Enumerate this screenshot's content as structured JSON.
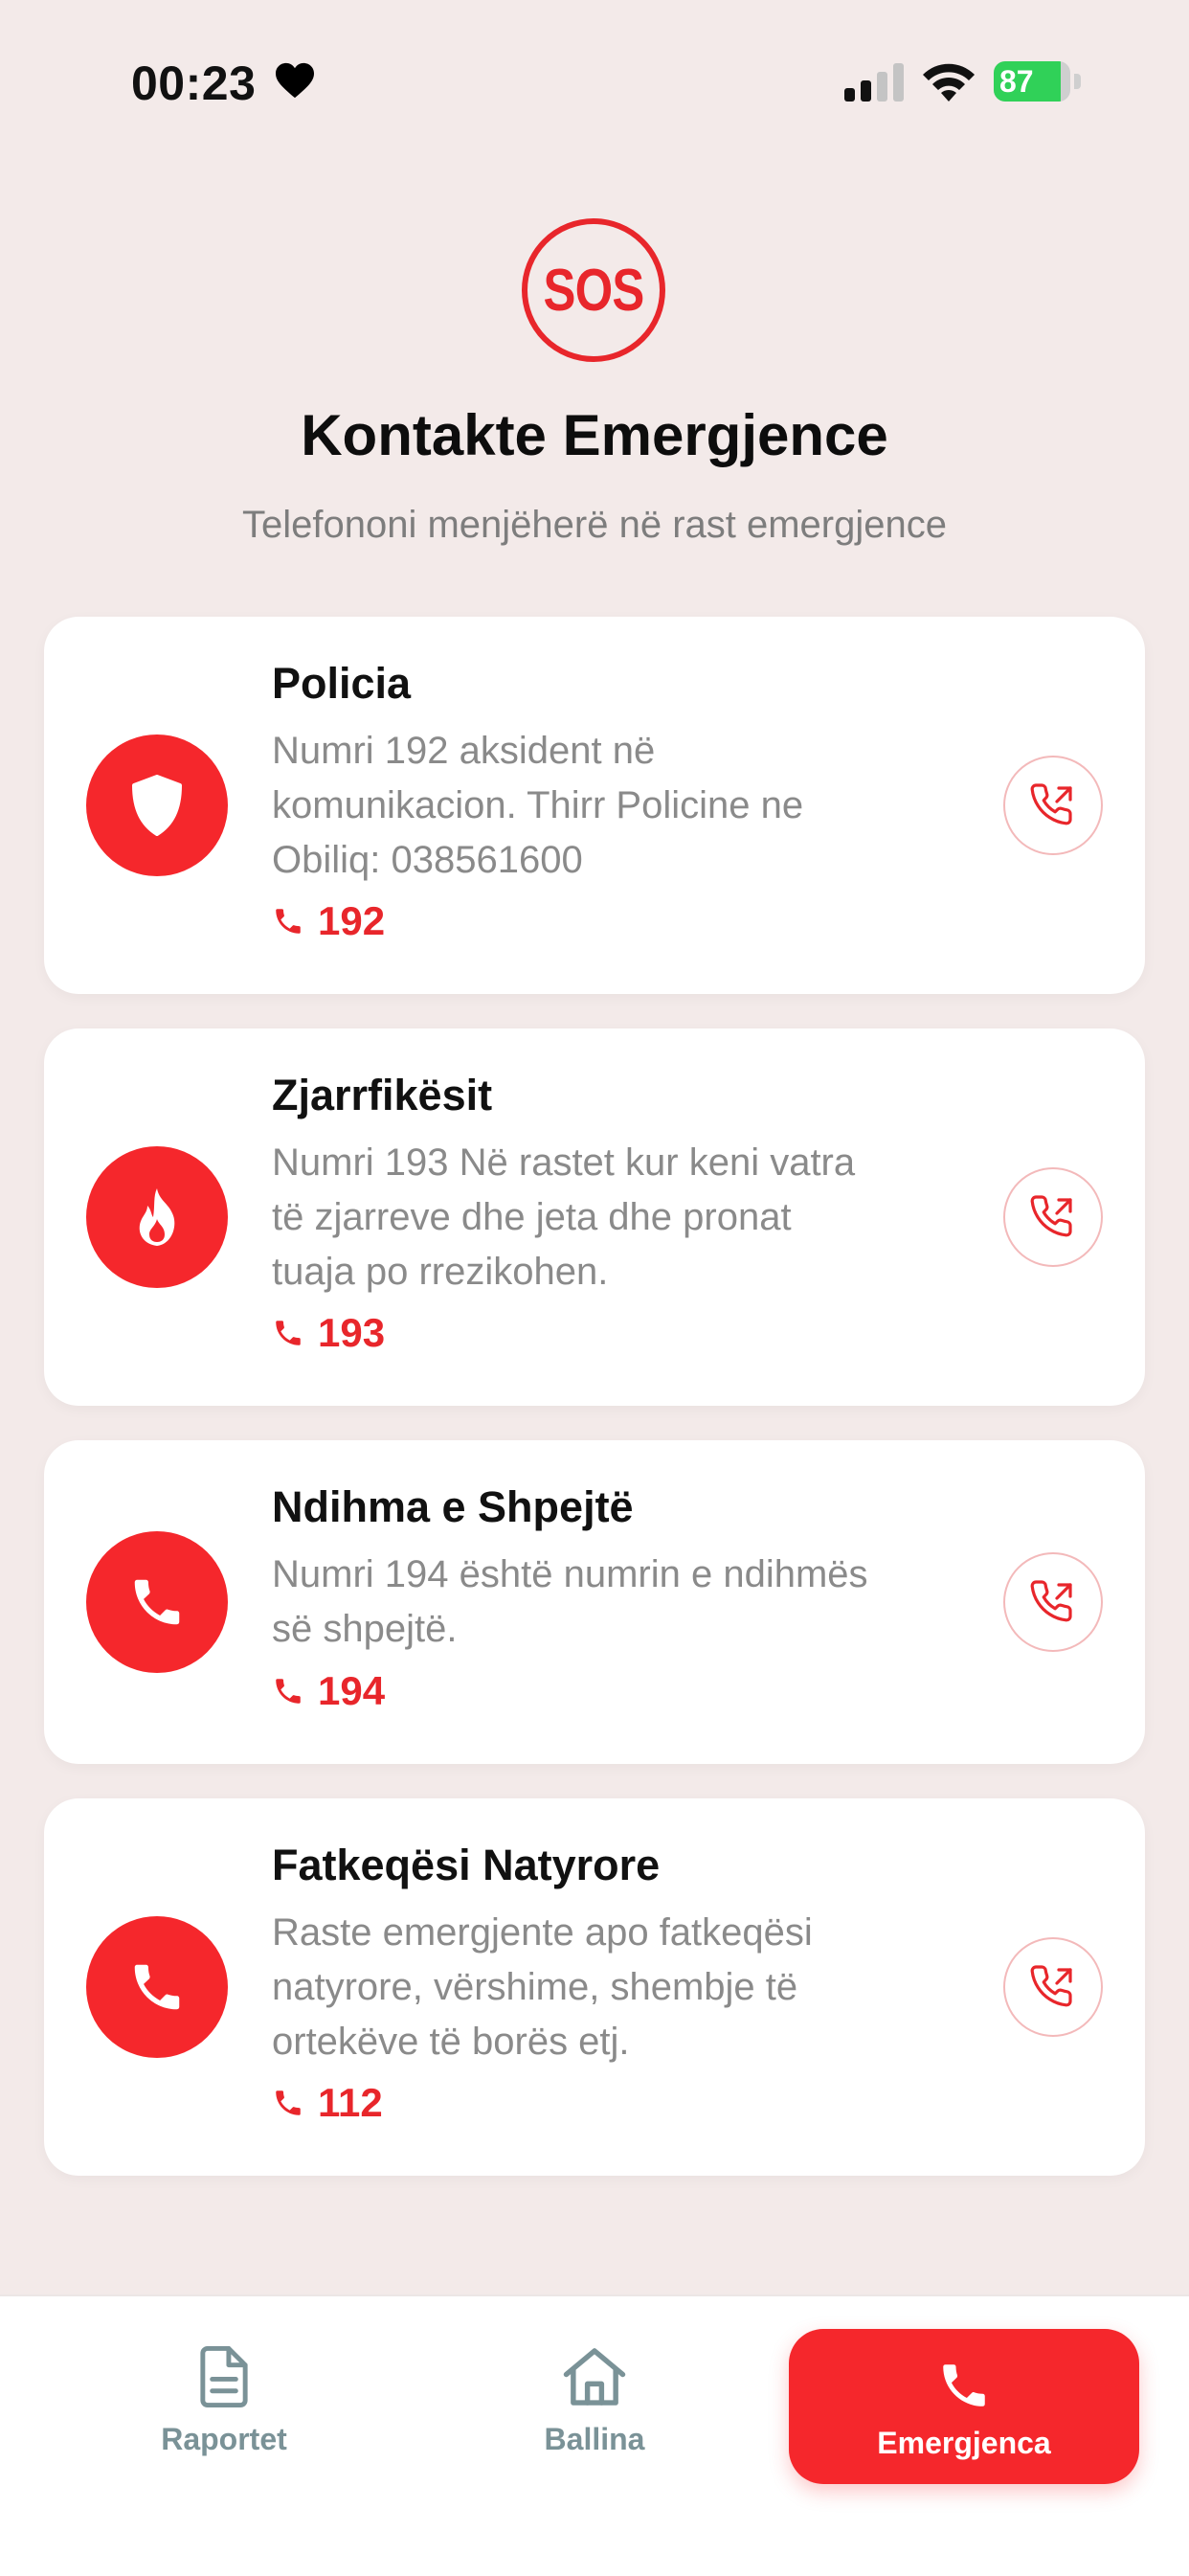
{
  "status_bar": {
    "time": "00:23",
    "battery_level": 87,
    "battery_text": "87",
    "icons": [
      "heart-icon",
      "cellular-signal-icon",
      "wifi-icon",
      "battery-icon"
    ]
  },
  "header": {
    "badge_text": "SOS",
    "title": "Kontakte Emergjence",
    "subtitle": "Telefononi menjëherë në rast emergjence"
  },
  "contacts": [
    {
      "title": "Policia",
      "description": "Numri 192 aksident në komunikacion. Thirr Policine ne Obiliq: 038561600",
      "number": "192",
      "icon": "shield-icon"
    },
    {
      "title": "Zjarrfikësit",
      "description": "Numri 193 Në rastet kur keni vatra të zjarreve dhe jeta dhe pronat tuaja po rrezikohen.",
      "number": "193",
      "icon": "flame-icon"
    },
    {
      "title": "Ndihma e Shpejtë",
      "description": "Numri 194 është numrin e ndihmës së shpejtë.",
      "number": "194",
      "icon": "phone-icon"
    },
    {
      "title": "Fatkeqësi Natyrore",
      "description": "Raste emergjente apo fatkeqësi natyrore, vërshime, shembje të ortekëve të borës etj.",
      "number": "112",
      "icon": "phone-icon"
    }
  ],
  "nav": {
    "items": [
      {
        "label": "Raportet",
        "icon": "document-icon",
        "active": false
      },
      {
        "label": "Ballina",
        "icon": "home-icon",
        "active": false
      },
      {
        "label": "Emergjenca",
        "icon": "phone-icon",
        "active": true
      }
    ]
  },
  "colors": {
    "accent": "#f5272c",
    "background": "#f3eae9",
    "nav_inactive": "#7a9297"
  }
}
